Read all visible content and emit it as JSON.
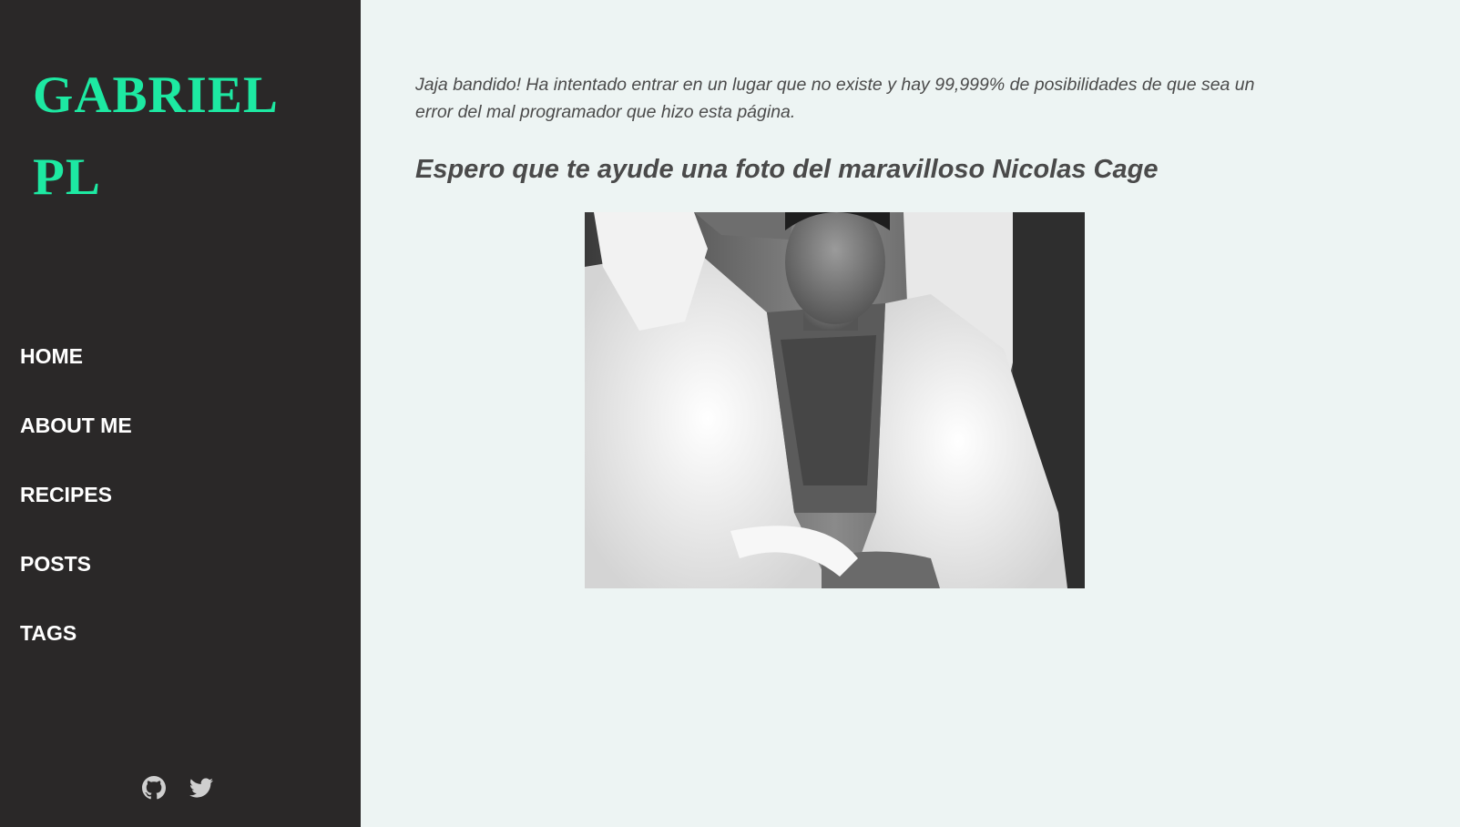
{
  "sidebar": {
    "brand": {
      "line1": "GABRIEL",
      "line2": "PL"
    },
    "nav": [
      {
        "label": "HOME"
      },
      {
        "label": "ABOUT ME"
      },
      {
        "label": "RECIPES"
      },
      {
        "label": "POSTS"
      },
      {
        "label": "TAGS"
      }
    ],
    "social_icons": [
      "github-icon",
      "twitter-icon"
    ]
  },
  "main": {
    "intro": "Jaja bandido! Ha intentado entrar en un lugar que no existe y hay 99,999% de posibilidades de que sea un error del mal programador que hizo esta página.",
    "subheading": "Espero que te ayude una foto del maravilloso Nicolas Cage"
  },
  "colors": {
    "sidebar_bg": "#2a2828",
    "brand_accent": "#1de9a2",
    "page_bg": "#edf4f3",
    "text": "#4b4b4b"
  }
}
